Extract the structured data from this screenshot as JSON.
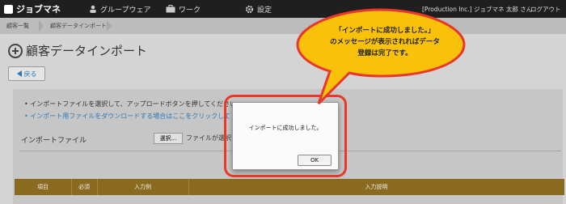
{
  "header": {
    "logo": "ジョブマネ",
    "nav": [
      {
        "label": "グループウェア",
        "icon": "user-icon"
      },
      {
        "label": "ワーク",
        "icon": "briefcase-icon"
      },
      {
        "label": "設定",
        "icon": "gear-icon"
      }
    ],
    "user": "[Production Inc.] ジョブマネ 太郎 さん",
    "logout": "ログアウト"
  },
  "breadcrumb": [
    "顧客一覧",
    "顧客データインポート"
  ],
  "page": {
    "title": "顧客データインポート",
    "back": "戻る"
  },
  "content": {
    "instructions": [
      "インポートファイルを選択して、アップロードボタンを押してください。",
      "インポート用ファイルをダウンロードする場合はここをクリックして"
    ],
    "file_label": "インポートファイル",
    "select_button": "選択...",
    "file_status": "ファイルが選択",
    "table_headers": [
      "項目",
      "必須",
      "入力例",
      "入力説明"
    ]
  },
  "dialog": {
    "message": "インポートに成功しました。",
    "ok": "OK"
  },
  "callout": {
    "lines": [
      "「インポートに成功しました。」",
      "のメッセージが表示されればデータ",
      "登録は完了です。"
    ],
    "fill": "#fac10a",
    "stroke": "#e8372b"
  }
}
